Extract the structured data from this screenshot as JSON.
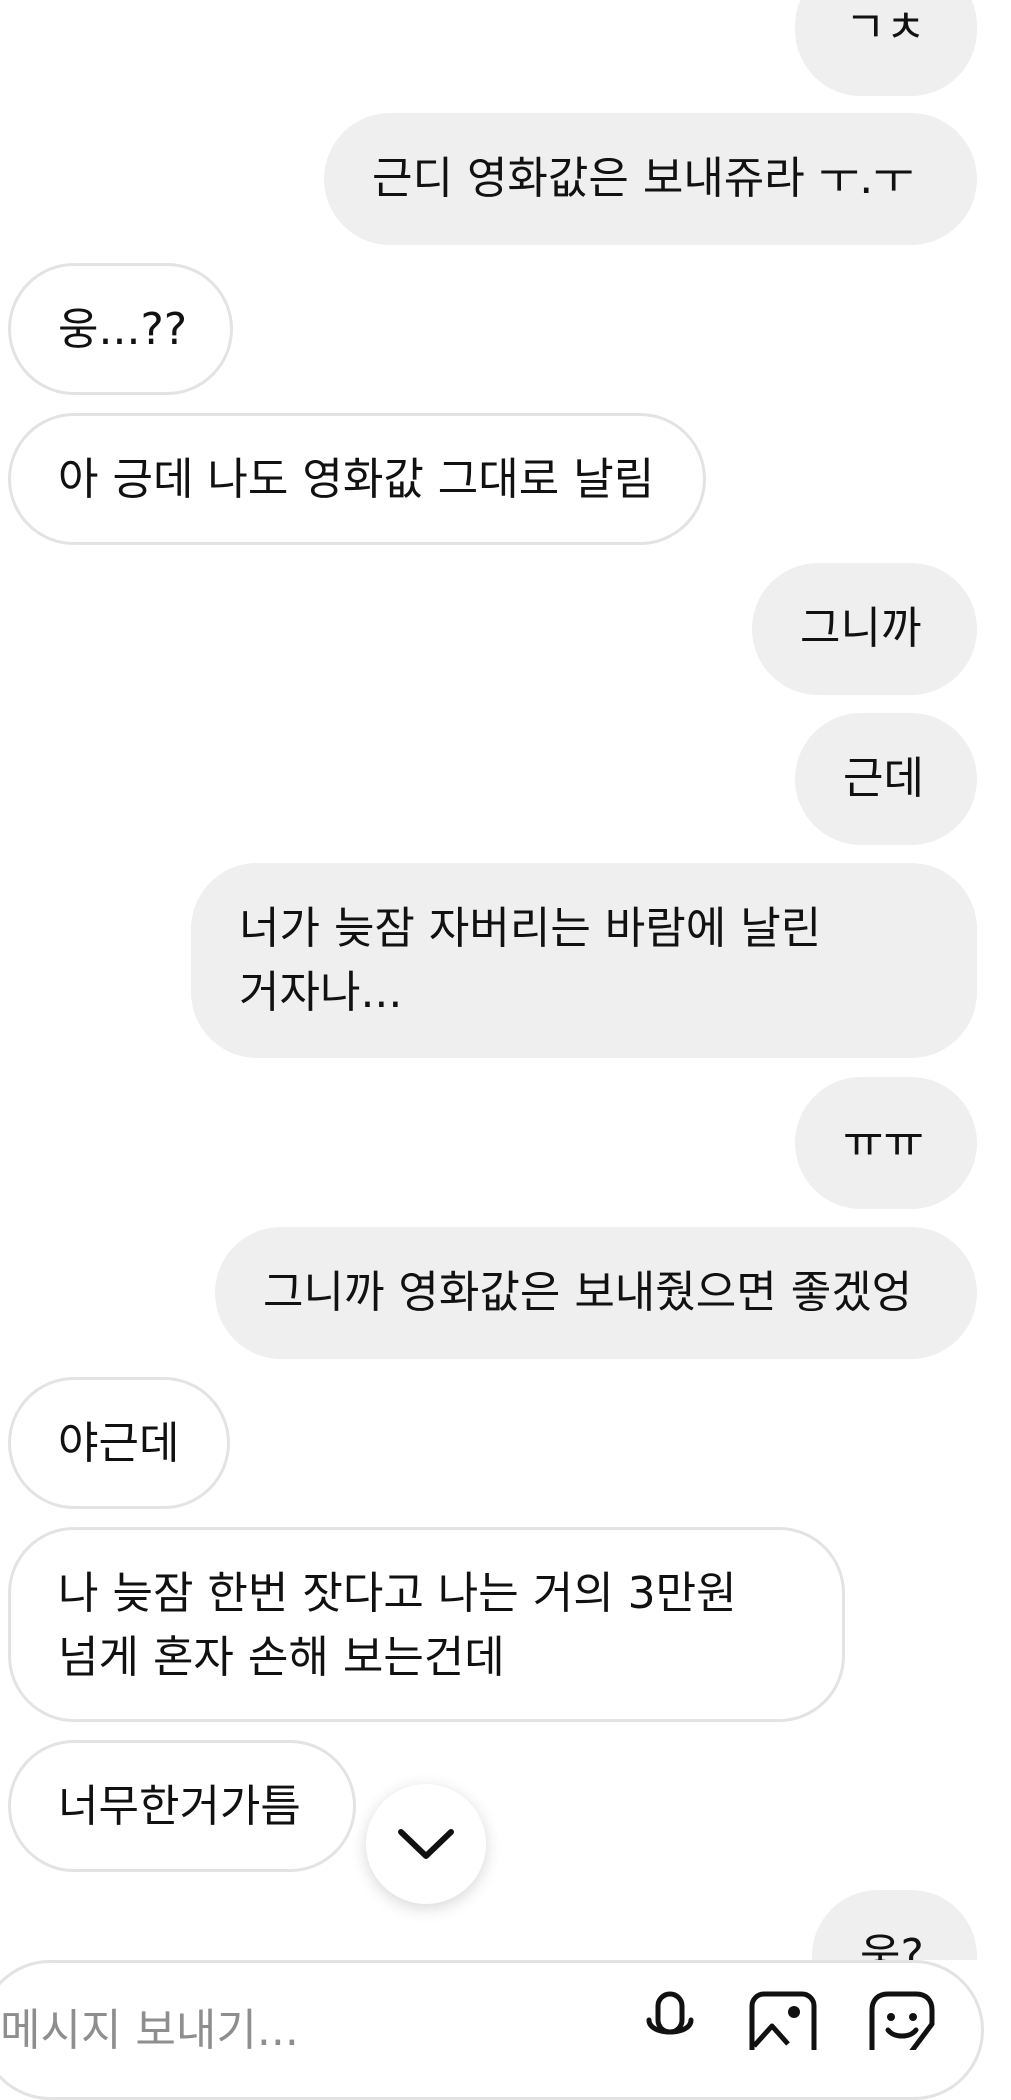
{
  "messages": [
    {
      "side": "sent",
      "text": "ㄱㅊ"
    },
    {
      "side": "sent",
      "text": "근디 영화값은 보내쥬라 ㅜ.ㅜ"
    },
    {
      "side": "received",
      "text": "웅...??"
    },
    {
      "side": "received",
      "text": "아 긍데 나도 영화값 그대로 날림"
    },
    {
      "side": "sent",
      "text": "그니까"
    },
    {
      "side": "sent",
      "text": "근데"
    },
    {
      "side": "sent",
      "text": "너가 늦잠 자버리는 바람에 날린 거자나..."
    },
    {
      "side": "sent",
      "text": "ㅠㅠ"
    },
    {
      "side": "sent",
      "text": "그니까 영화값은 보내줬으면 좋겠엉"
    },
    {
      "side": "received",
      "text": "야근데"
    },
    {
      "side": "received",
      "text": "나 늦잠 한번 잣다고 나는 거의 3만원 넘게 혼자 손해 보는건데"
    },
    {
      "side": "received",
      "text": "너무한거가틈"
    },
    {
      "side": "sent",
      "text": "웅?"
    }
  ],
  "scroll_button": {
    "icon": "chevron-down-icon"
  },
  "composer": {
    "placeholder": "메시지 보내기...",
    "icons": [
      "microphone-icon",
      "image-icon",
      "sticker-icon"
    ]
  },
  "colors": {
    "sent_bubble": "#efefef",
    "received_border": "#e3e3e3",
    "text": "#111111",
    "placeholder": "#8e8e8e"
  }
}
